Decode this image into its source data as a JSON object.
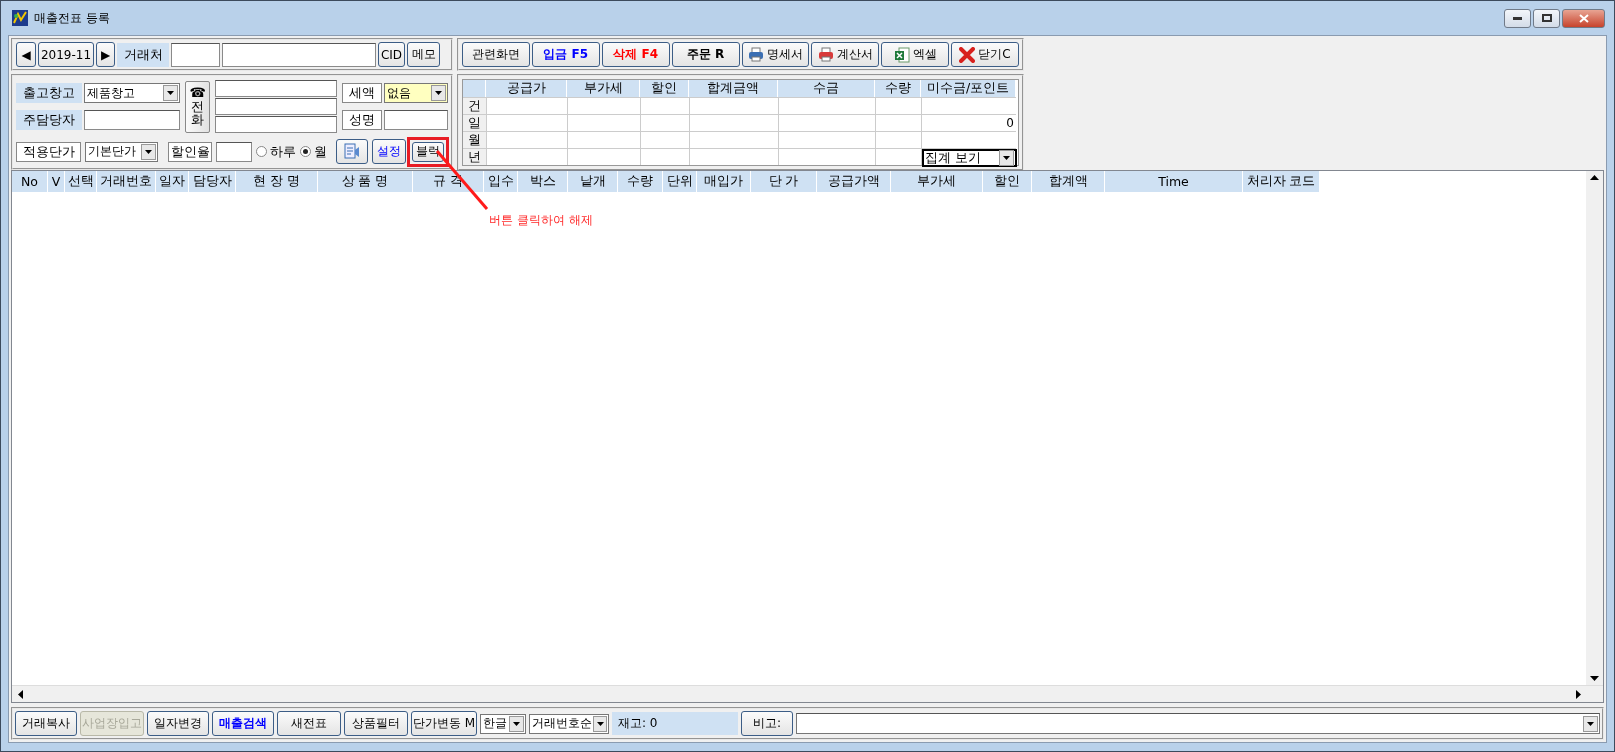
{
  "window": {
    "title": "매출전표 등록"
  },
  "period": {
    "prev": "◀",
    "value": "2019-11",
    "next": "▶"
  },
  "customer": {
    "label": "거래처",
    "buttons": [
      "CID",
      "메모"
    ]
  },
  "warehouse": {
    "label": "출고창고",
    "value": "제품창고"
  },
  "manager": {
    "label": "주담당자"
  },
  "phone": {
    "icon": "☎",
    "label": "전화"
  },
  "tax": {
    "label": "세액",
    "value": "없음"
  },
  "name_field": {
    "label": "성명"
  },
  "price": {
    "label": "적용단가",
    "value": "기본단가"
  },
  "discount": {
    "label": "할인율"
  },
  "period_options": [
    {
      "label": "하루",
      "selected": false
    },
    {
      "label": "월",
      "selected": true
    }
  ],
  "settings_button": "설정",
  "block_button": {
    "label": "블럭",
    "highlighted": true
  },
  "toolbar": [
    {
      "label": "관련화면",
      "kind": "plain"
    },
    {
      "label": "입금 F5",
      "kind": "blue"
    },
    {
      "label": "삭제 F4",
      "kind": "red"
    },
    {
      "label": "주문 R",
      "kind": "bold"
    },
    {
      "label": "명세서",
      "kind": "printer"
    },
    {
      "label": "계산서",
      "kind": "printer-red"
    },
    {
      "label": "엑셀",
      "kind": "spreadsheet"
    },
    {
      "label": "닫기C",
      "kind": "close"
    }
  ],
  "summary": {
    "columns": [
      "공급가",
      "부가세",
      "할인",
      "합계금액",
      "수금",
      "수량",
      "미수금/포인트"
    ],
    "rows": [
      {
        "label": "건"
      },
      {
        "label": "일",
        "balance": "0"
      },
      {
        "label": "월"
      },
      {
        "label": "년"
      }
    ],
    "view_select": "집계 보기"
  },
  "table": {
    "columns": [
      "No",
      "V",
      "선택",
      "거래번호",
      "일자",
      "담당자",
      "현 장 명",
      "상 품 명",
      "규 격",
      "입수",
      "박스",
      "낱개",
      "수량",
      "단위",
      "매입가",
      "단 가",
      "공급가액",
      "부가세",
      "할인",
      "합계액",
      "Time",
      "처리자 코드"
    ]
  },
  "annotation": {
    "text": "버튼 클릭하여 해제"
  },
  "bottom_buttons": [
    {
      "label": "거래복사",
      "kind": "plain",
      "disabled": false
    },
    {
      "label": "사업장입고",
      "kind": "plain",
      "disabled": true
    },
    {
      "label": "일자변경",
      "kind": "plain",
      "disabled": false
    },
    {
      "label": "매출검색",
      "kind": "blue",
      "disabled": false
    },
    {
      "label": "새전표",
      "kind": "plain",
      "disabled": false
    },
    {
      "label": "상품필터",
      "kind": "plain",
      "disabled": false
    },
    {
      "label": "단가변동 M",
      "kind": "plain",
      "disabled": false
    }
  ],
  "bottom_selects": [
    "한글",
    "거래번호순"
  ],
  "stock": "재고: 0",
  "memo_label": "비고:"
}
